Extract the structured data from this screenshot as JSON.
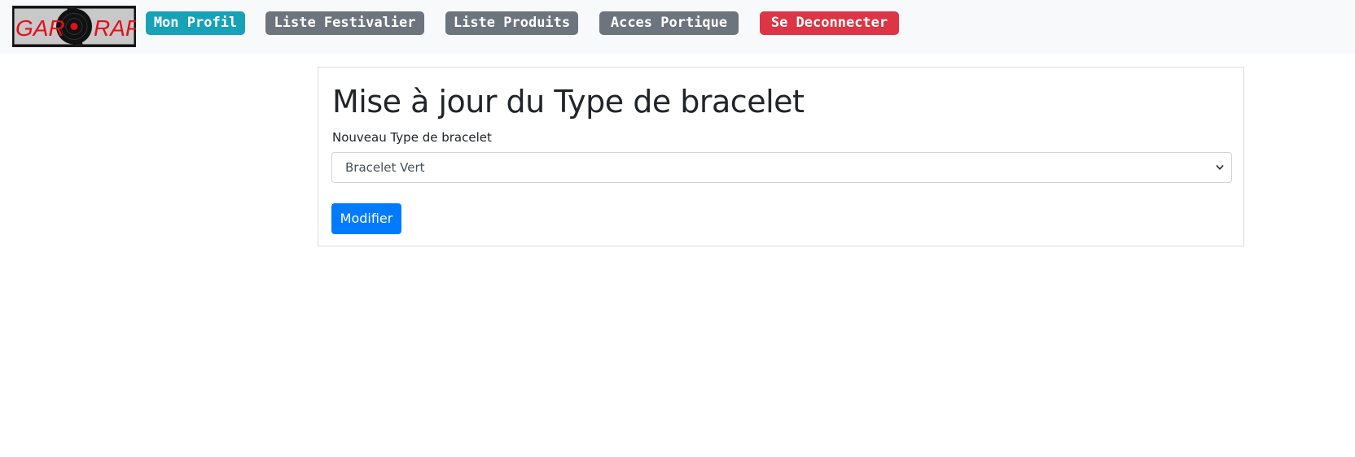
{
  "logo": {
    "left_text": "GAR",
    "right_text": "RAP"
  },
  "nav": {
    "profile_label": "Mon Profil",
    "festivaliers_label": "Liste Festivalier",
    "produits_label": "Liste Produits",
    "portique_label": "Acces Portique",
    "logout_label": "Se Deconnecter"
  },
  "form": {
    "title": "Mise à jour du Type de bracelet",
    "field_label": "Nouveau Type de bracelet",
    "selected_value": "Bracelet Vert",
    "submit_label": "Modifier"
  },
  "colors": {
    "navbar_bg": "#f8f9fa",
    "info": "#17a2b8",
    "secondary": "#6c757d",
    "danger": "#dc3545",
    "primary": "#007bff",
    "logo_text": "#e0101c"
  }
}
